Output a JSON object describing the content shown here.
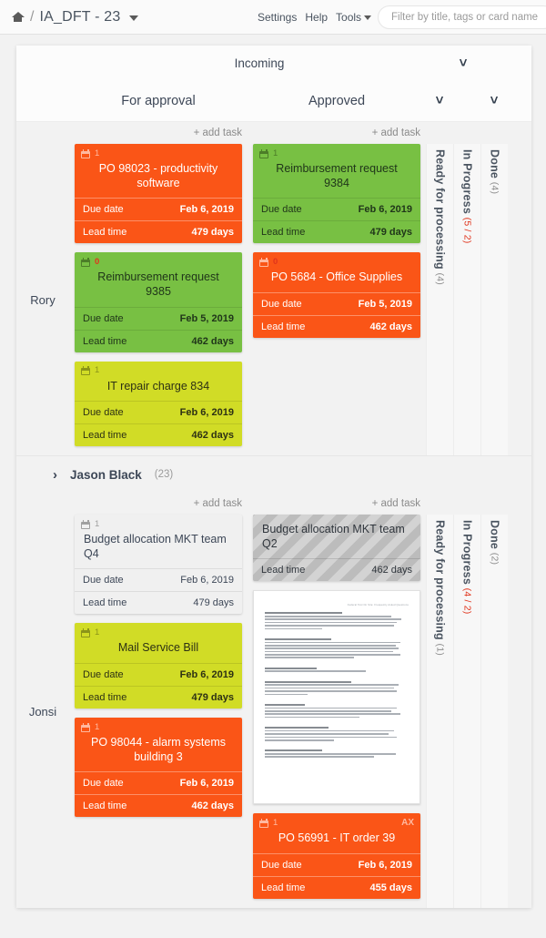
{
  "topbar": {
    "home_icon": "home-icon",
    "separator": "/",
    "board_title": "IA_DFT - 23",
    "nav": {
      "settings": "Settings",
      "help": "Help",
      "tools": "Tools"
    },
    "filter_placeholder": "Filter by title, tags or card name",
    "filter_value": ""
  },
  "board": {
    "parent_column": "Incoming",
    "columns": [
      {
        "name": "For approval",
        "add_task": "+ add task"
      },
      {
        "name": "Approved",
        "add_task": "+ add task"
      }
    ],
    "collapsed_columns_lane1": [
      {
        "name": "Ready for processing",
        "count": "(4)",
        "wip": false
      },
      {
        "name": "In Progress",
        "count": "(5 / 2)",
        "wip": true
      },
      {
        "name": "Done",
        "count": "(4)",
        "wip": false
      }
    ],
    "collapsed_columns_lane2": [
      {
        "name": "Ready for processing",
        "count": "(1)",
        "wip": false
      },
      {
        "name": "In Progress",
        "count": "(4 / 2)",
        "wip": true
      },
      {
        "name": "Done",
        "count": "(2)",
        "wip": false
      }
    ],
    "labels": {
      "due_date": "Due date",
      "lead_time": "Lead time"
    }
  },
  "lanes": [
    {
      "name": "Rory",
      "for_approval": [
        {
          "title": "PO 98023 - productivity software",
          "badge": "1",
          "badge_alert": false,
          "due_date": "Feb 6, 2019",
          "lead_time": "479 days",
          "color": "orange"
        },
        {
          "title": "Reimbursement request 9385",
          "badge": "0",
          "badge_alert": true,
          "due_date": "Feb 5, 2019",
          "lead_time": "462 days",
          "color": "green"
        },
        {
          "title": "IT repair charge 834",
          "badge": "1",
          "badge_alert": false,
          "due_date": "Feb 6, 2019",
          "lead_time": "462 days",
          "color": "lime"
        }
      ],
      "approved": [
        {
          "title": "Reimbursement request 9384",
          "badge": "1",
          "badge_alert": false,
          "due_date": "Feb 6, 2019",
          "lead_time": "479 days",
          "color": "green"
        },
        {
          "title": "PO 5684 - Office Supplies",
          "badge": "0",
          "badge_alert": true,
          "due_date": "Feb 5, 2019",
          "lead_time": "462 days",
          "color": "orange"
        }
      ]
    },
    {
      "name": "Jason Black",
      "collapsed": true,
      "count": "(23)"
    },
    {
      "name": "Jonsi",
      "for_approval": [
        {
          "title": "Budget allocation MKT team Q4",
          "badge": "1",
          "badge_alert": false,
          "due_date": "Feb 6, 2019",
          "lead_time": "479 days",
          "color": "plain"
        },
        {
          "title": "Mail Service Bill",
          "badge": "1",
          "badge_alert": false,
          "due_date": "Feb 6, 2019",
          "lead_time": "479 days",
          "color": "lime"
        },
        {
          "title": "PO 98044 - alarm systems building 3",
          "badge": "1",
          "badge_alert": false,
          "due_date": "Feb 6, 2019",
          "lead_time": "462 days",
          "color": "orange"
        }
      ],
      "approved": [
        {
          "title": "Budget allocation MKT team Q2",
          "badge": "",
          "badge_alert": false,
          "lead_time": "462 days",
          "color": "striped",
          "no_due_date": true
        },
        {
          "title": "",
          "color": "document",
          "doc_header": "Federal Tool On Site: Frequently Asked Questions"
        },
        {
          "title": "PO 56991 - IT order 39",
          "badge": "1",
          "badge_alert": false,
          "tag": "AX",
          "due_date": "Feb 6, 2019",
          "lead_time": "455 days",
          "color": "orange"
        }
      ]
    }
  ]
}
